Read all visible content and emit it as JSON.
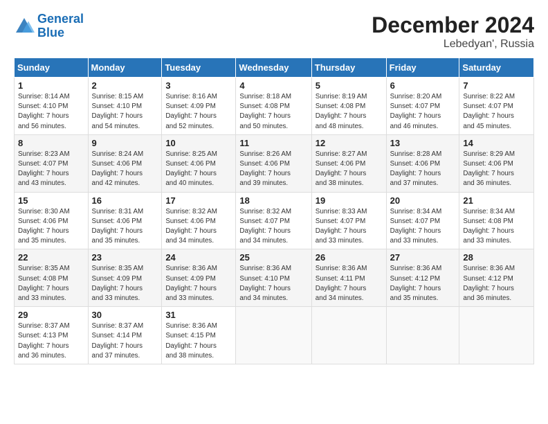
{
  "header": {
    "logo_line1": "General",
    "logo_line2": "Blue",
    "month": "December 2024",
    "location": "Lebedyan', Russia"
  },
  "days_of_week": [
    "Sunday",
    "Monday",
    "Tuesday",
    "Wednesday",
    "Thursday",
    "Friday",
    "Saturday"
  ],
  "weeks": [
    [
      {
        "num": "1",
        "info": "Sunrise: 8:14 AM\nSunset: 4:10 PM\nDaylight: 7 hours\nand 56 minutes."
      },
      {
        "num": "2",
        "info": "Sunrise: 8:15 AM\nSunset: 4:10 PM\nDaylight: 7 hours\nand 54 minutes."
      },
      {
        "num": "3",
        "info": "Sunrise: 8:16 AM\nSunset: 4:09 PM\nDaylight: 7 hours\nand 52 minutes."
      },
      {
        "num": "4",
        "info": "Sunrise: 8:18 AM\nSunset: 4:08 PM\nDaylight: 7 hours\nand 50 minutes."
      },
      {
        "num": "5",
        "info": "Sunrise: 8:19 AM\nSunset: 4:08 PM\nDaylight: 7 hours\nand 48 minutes."
      },
      {
        "num": "6",
        "info": "Sunrise: 8:20 AM\nSunset: 4:07 PM\nDaylight: 7 hours\nand 46 minutes."
      },
      {
        "num": "7",
        "info": "Sunrise: 8:22 AM\nSunset: 4:07 PM\nDaylight: 7 hours\nand 45 minutes."
      }
    ],
    [
      {
        "num": "8",
        "info": "Sunrise: 8:23 AM\nSunset: 4:07 PM\nDaylight: 7 hours\nand 43 minutes."
      },
      {
        "num": "9",
        "info": "Sunrise: 8:24 AM\nSunset: 4:06 PM\nDaylight: 7 hours\nand 42 minutes."
      },
      {
        "num": "10",
        "info": "Sunrise: 8:25 AM\nSunset: 4:06 PM\nDaylight: 7 hours\nand 40 minutes."
      },
      {
        "num": "11",
        "info": "Sunrise: 8:26 AM\nSunset: 4:06 PM\nDaylight: 7 hours\nand 39 minutes."
      },
      {
        "num": "12",
        "info": "Sunrise: 8:27 AM\nSunset: 4:06 PM\nDaylight: 7 hours\nand 38 minutes."
      },
      {
        "num": "13",
        "info": "Sunrise: 8:28 AM\nSunset: 4:06 PM\nDaylight: 7 hours\nand 37 minutes."
      },
      {
        "num": "14",
        "info": "Sunrise: 8:29 AM\nSunset: 4:06 PM\nDaylight: 7 hours\nand 36 minutes."
      }
    ],
    [
      {
        "num": "15",
        "info": "Sunrise: 8:30 AM\nSunset: 4:06 PM\nDaylight: 7 hours\nand 35 minutes."
      },
      {
        "num": "16",
        "info": "Sunrise: 8:31 AM\nSunset: 4:06 PM\nDaylight: 7 hours\nand 35 minutes."
      },
      {
        "num": "17",
        "info": "Sunrise: 8:32 AM\nSunset: 4:06 PM\nDaylight: 7 hours\nand 34 minutes."
      },
      {
        "num": "18",
        "info": "Sunrise: 8:32 AM\nSunset: 4:07 PM\nDaylight: 7 hours\nand 34 minutes."
      },
      {
        "num": "19",
        "info": "Sunrise: 8:33 AM\nSunset: 4:07 PM\nDaylight: 7 hours\nand 33 minutes."
      },
      {
        "num": "20",
        "info": "Sunrise: 8:34 AM\nSunset: 4:07 PM\nDaylight: 7 hours\nand 33 minutes."
      },
      {
        "num": "21",
        "info": "Sunrise: 8:34 AM\nSunset: 4:08 PM\nDaylight: 7 hours\nand 33 minutes."
      }
    ],
    [
      {
        "num": "22",
        "info": "Sunrise: 8:35 AM\nSunset: 4:08 PM\nDaylight: 7 hours\nand 33 minutes."
      },
      {
        "num": "23",
        "info": "Sunrise: 8:35 AM\nSunset: 4:09 PM\nDaylight: 7 hours\nand 33 minutes."
      },
      {
        "num": "24",
        "info": "Sunrise: 8:36 AM\nSunset: 4:09 PM\nDaylight: 7 hours\nand 33 minutes."
      },
      {
        "num": "25",
        "info": "Sunrise: 8:36 AM\nSunset: 4:10 PM\nDaylight: 7 hours\nand 34 minutes."
      },
      {
        "num": "26",
        "info": "Sunrise: 8:36 AM\nSunset: 4:11 PM\nDaylight: 7 hours\nand 34 minutes."
      },
      {
        "num": "27",
        "info": "Sunrise: 8:36 AM\nSunset: 4:12 PM\nDaylight: 7 hours\nand 35 minutes."
      },
      {
        "num": "28",
        "info": "Sunrise: 8:36 AM\nSunset: 4:12 PM\nDaylight: 7 hours\nand 36 minutes."
      }
    ],
    [
      {
        "num": "29",
        "info": "Sunrise: 8:37 AM\nSunset: 4:13 PM\nDaylight: 7 hours\nand 36 minutes."
      },
      {
        "num": "30",
        "info": "Sunrise: 8:37 AM\nSunset: 4:14 PM\nDaylight: 7 hours\nand 37 minutes."
      },
      {
        "num": "31",
        "info": "Sunrise: 8:36 AM\nSunset: 4:15 PM\nDaylight: 7 hours\nand 38 minutes."
      },
      {
        "num": "",
        "info": ""
      },
      {
        "num": "",
        "info": ""
      },
      {
        "num": "",
        "info": ""
      },
      {
        "num": "",
        "info": ""
      }
    ]
  ]
}
